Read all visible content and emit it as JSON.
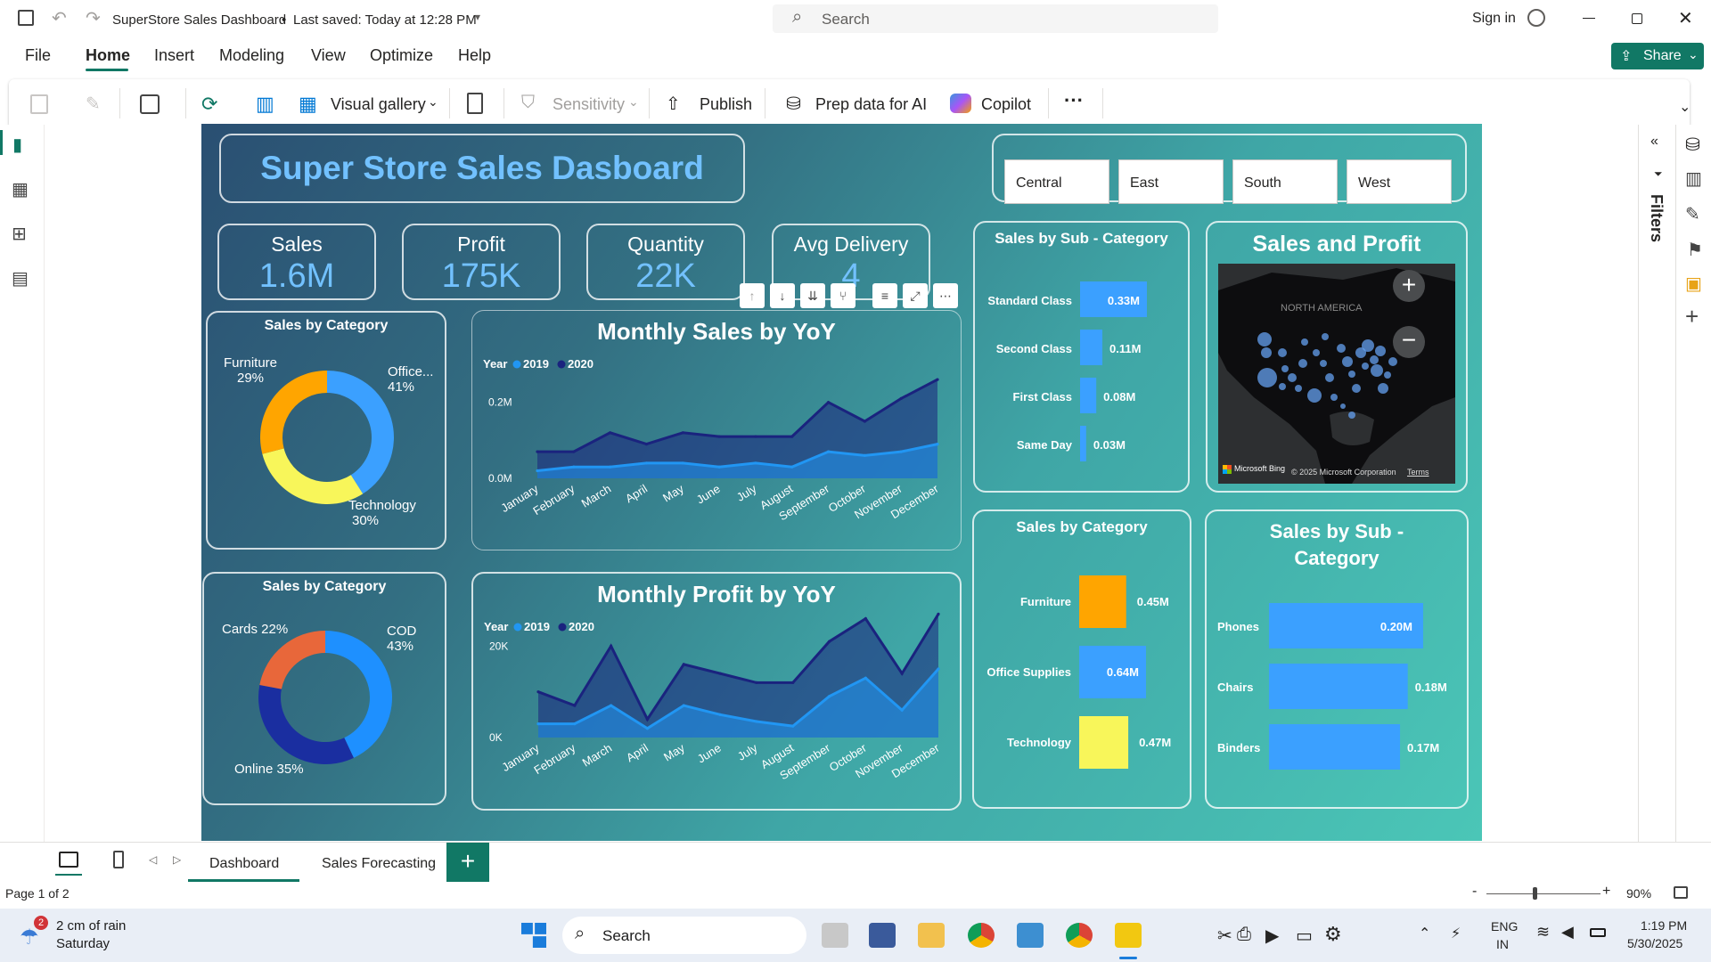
{
  "titlebar": {
    "doc_title": "SuperStore Sales Dashboard",
    "saved_status": "Last saved: Today at 12:28 PM",
    "search_placeholder": "Search",
    "sign_in": "Sign in"
  },
  "menu": {
    "items": [
      "File",
      "Home",
      "Insert",
      "Modeling",
      "View",
      "Optimize",
      "Help"
    ],
    "active": "Home",
    "share_label": "Share"
  },
  "ribbon": {
    "visual_gallery": "Visual gallery",
    "sensitivity": "Sensitivity",
    "publish": "Publish",
    "prep_data": "Prep data for AI",
    "copilot": "Copilot",
    "more": "···"
  },
  "dashboard": {
    "title": "Super Store Sales Dasboard",
    "regions": [
      "Central",
      "East",
      "South",
      "West"
    ],
    "kpis": [
      {
        "label": "Sales",
        "value": "1.6M"
      },
      {
        "label": "Profit",
        "value": "175K"
      },
      {
        "label": "Quantity",
        "value": "22K"
      },
      {
        "label": "Avg Delivery",
        "value": "4"
      }
    ],
    "sales_by_category_donut": {
      "title": "Sales by Category",
      "labels": [
        {
          "name": "Furniture",
          "pct": "29%"
        },
        {
          "name": "Office...",
          "pct": "41%"
        },
        {
          "name": "Technology",
          "pct": "30%"
        }
      ]
    },
    "payment_donut": {
      "title": "Sales by Category",
      "labels": [
        {
          "name": "Cards 22%"
        },
        {
          "name": "COD",
          "pct": "43%"
        },
        {
          "name": "Online 35%"
        }
      ]
    },
    "monthly_sales": {
      "title": "Monthly Sales by YoY",
      "legend_title": "Year",
      "series": [
        "2019",
        "2020"
      ],
      "yticks": [
        "0.2M",
        "0.0M"
      ]
    },
    "monthly_profit": {
      "title": "Monthly Profit by YoY",
      "legend_title": "Year",
      "series": [
        "2019",
        "2020"
      ],
      "yticks": [
        "20K",
        "0K"
      ]
    },
    "ship_mode": {
      "title": "Sales by Sub - Category",
      "bars": [
        {
          "label": "Standard Class",
          "value_label": "0.33M"
        },
        {
          "label": "Second Class",
          "value_label": "0.11M"
        },
        {
          "label": "First Class",
          "value_label": "0.08M"
        },
        {
          "label": "Same Day",
          "value_label": "0.03M"
        }
      ]
    },
    "map": {
      "title": "Sales and Profit",
      "region_label": "NORTH AMERICA",
      "attribution": "Microsoft Bing",
      "copyright": "© 2025 Microsoft Corporation",
      "terms": "Terms"
    },
    "category_bars": {
      "title": "Sales by Category",
      "bars": [
        {
          "label": "Furniture",
          "value_label": "0.45M",
          "color": "#ffa500"
        },
        {
          "label": "Office Supplies",
          "value_label": "0.64M",
          "color": "#3ba0ff"
        },
        {
          "label": "Technology",
          "value_label": "0.47M",
          "color": "#f8f65a"
        }
      ]
    },
    "subcat_bars": {
      "title_line1": "Sales by Sub -",
      "title_line2": "Category",
      "bars": [
        {
          "label": "Phones",
          "value_label": "0.20M"
        },
        {
          "label": "Chairs",
          "value_label": "0.18M"
        },
        {
          "label": "Binders",
          "value_label": "0.17M"
        }
      ]
    }
  },
  "chart_data": [
    {
      "type": "line",
      "title": "Monthly Sales by YoY",
      "x": [
        "January",
        "February",
        "March",
        "April",
        "May",
        "June",
        "July",
        "August",
        "September",
        "October",
        "November",
        "December"
      ],
      "series": [
        {
          "name": "2019",
          "values": [
            0.02,
            0.03,
            0.03,
            0.04,
            0.04,
            0.03,
            0.04,
            0.03,
            0.07,
            0.06,
            0.07,
            0.09
          ]
        },
        {
          "name": "2020",
          "values": [
            0.07,
            0.07,
            0.12,
            0.09,
            0.12,
            0.11,
            0.11,
            0.11,
            0.2,
            0.15,
            0.21,
            0.26
          ]
        }
      ],
      "ylim": [
        0,
        0.3
      ]
    },
    {
      "type": "line",
      "title": "Monthly Profit by YoY",
      "x": [
        "January",
        "February",
        "March",
        "April",
        "May",
        "June",
        "July",
        "August",
        "September",
        "October",
        "November",
        "December"
      ],
      "series": [
        {
          "name": "2019",
          "values": [
            3000,
            3000,
            7000,
            2000,
            7000,
            5000,
            3500,
            2500,
            9000,
            13000,
            6000,
            15000
          ]
        },
        {
          "name": "2020",
          "values": [
            10000,
            7000,
            20000,
            4000,
            16000,
            14000,
            12000,
            12000,
            21000,
            26000,
            14000,
            27000
          ]
        }
      ],
      "ylim": [
        0,
        30000
      ]
    },
    {
      "type": "pie",
      "title": "Sales by Category",
      "categories": [
        "Office...",
        "Technology",
        "Furniture"
      ],
      "values": [
        41,
        30,
        29
      ],
      "colors": [
        "#3ba0ff",
        "#f8f65a",
        "#ffa500"
      ]
    },
    {
      "type": "pie",
      "title": "Sales by Category",
      "categories": [
        "COD",
        "Online",
        "Cards"
      ],
      "values": [
        43,
        35,
        22
      ],
      "colors": [
        "#1e90ff",
        "#1a2ea0",
        "#e8673a"
      ]
    },
    {
      "type": "bar",
      "title": "Sales by Sub - Category",
      "categories": [
        "Standard Class",
        "Second Class",
        "First Class",
        "Same Day"
      ],
      "values": [
        0.33,
        0.11,
        0.08,
        0.03
      ]
    },
    {
      "type": "bar",
      "title": "Sales by Category",
      "categories": [
        "Furniture",
        "Office Supplies",
        "Technology"
      ],
      "values": [
        0.45,
        0.64,
        0.47
      ]
    },
    {
      "type": "bar",
      "title": "Sales by Sub - Category",
      "categories": [
        "Phones",
        "Chairs",
        "Binders"
      ],
      "values": [
        0.2,
        0.18,
        0.17
      ]
    }
  ],
  "filters_label": "Filters",
  "tabs": {
    "items": [
      "Dashboard",
      "Sales Forecasting"
    ],
    "active": "Dashboard",
    "add": "+"
  },
  "status": {
    "page": "Page 1 of 2",
    "zoom": "90%"
  },
  "taskbar": {
    "weather_badge": "2",
    "weather": "2 cm of rain",
    "day": "Saturday",
    "search": "Search",
    "lang1": "ENG",
    "lang2": "IN",
    "time": "1:19 PM",
    "date": "5/30/2025"
  }
}
